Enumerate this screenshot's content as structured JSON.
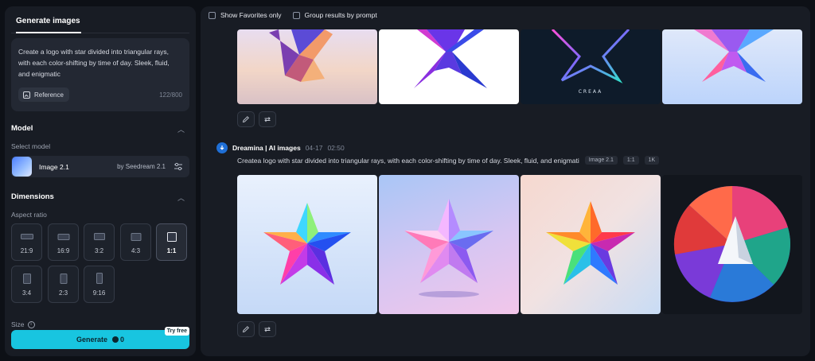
{
  "left_panel": {
    "tab_label": "Generate images",
    "prompt": {
      "text": "Create a logo with star divided into triangular rays, with each color-shifting by time of day. Sleek, fluid, and enigmatic",
      "reference_label": "Reference",
      "char_count": "122/800"
    },
    "model": {
      "section_title": "Model",
      "select_label": "Select model",
      "name": "Image 2.1",
      "provider": "by Seedream 2.1"
    },
    "dimensions": {
      "section_title": "Dimensions",
      "aspect_label": "Aspect ratio",
      "ratios": [
        "21:9",
        "16:9",
        "3:2",
        "4:3",
        "1:1",
        "3:4",
        "2:3",
        "9:16"
      ],
      "selected": "1:1",
      "size_label": "Size"
    },
    "generate": {
      "label": "Generate",
      "cost": "0",
      "badge": "Try free"
    }
  },
  "toolbar": {
    "show_favorites": "Show Favorites only",
    "group_by_prompt": "Group results by prompt"
  },
  "results": {
    "brand": "Dreamina | AI images",
    "date": "04-17",
    "time": "02:50",
    "prompt": "Createa logo with star divided into triangular rays, with each color-shifting by time of day. Sleek, fluid, and enigmati",
    "tags": [
      "Image 2.1",
      "1:1",
      "1K"
    ],
    "top_image_text": "CREAA"
  },
  "colors": {
    "accent": "#18c5e0",
    "panel": "#181c24",
    "background": "#0d1016"
  }
}
